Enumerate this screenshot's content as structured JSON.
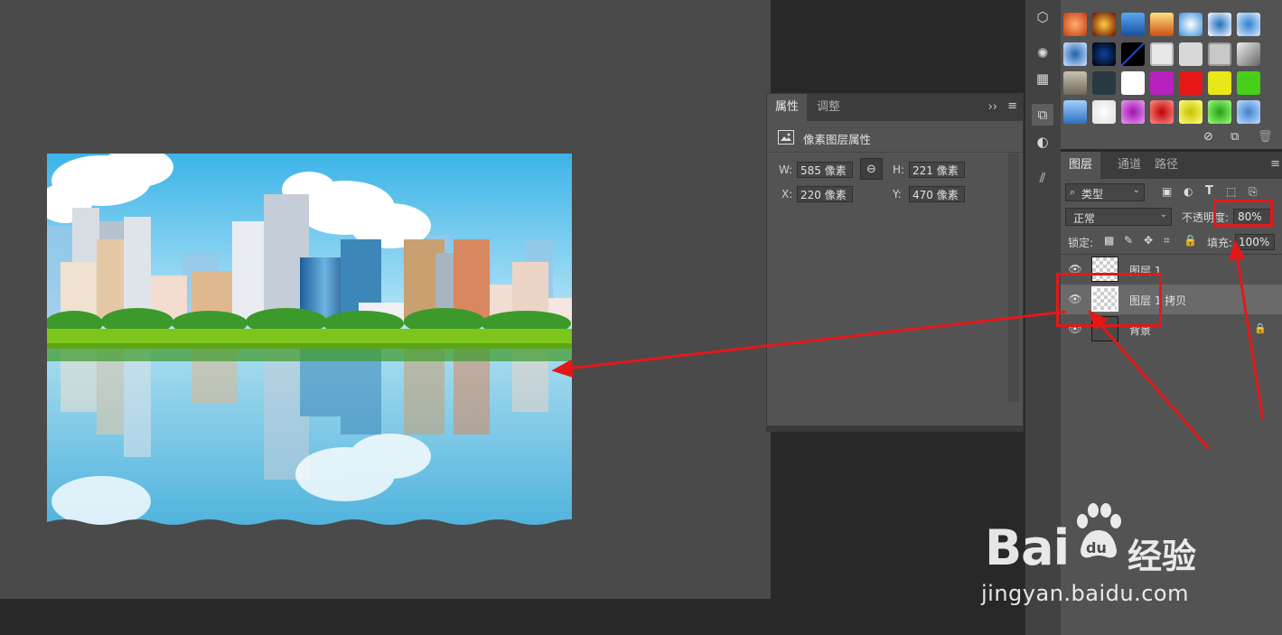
{
  "properties_panel": {
    "tabs": [
      "属性",
      "调整"
    ],
    "section_title": "像素图层属性",
    "w_label": "W:",
    "w_value": "585 像素",
    "h_label": "H:",
    "h_value": "221 像素",
    "x_label": "X:",
    "x_value": "220 像素",
    "y_label": "Y:",
    "y_value": "470 像素"
  },
  "layers_panel": {
    "tabs": [
      "图层",
      "通道",
      "路径"
    ],
    "filter_kind": "类型",
    "blend_mode": "正常",
    "opacity_label": "不透明度:",
    "opacity_value": "80%",
    "lock_label": "锁定:",
    "fill_label": "填充:",
    "fill_value": "100%",
    "layers": [
      {
        "name": "图层 1"
      },
      {
        "name": "图层 1 拷贝"
      },
      {
        "name": "背景"
      }
    ]
  },
  "watermark": {
    "brand": "Bai",
    "brand_du": "du",
    "brand_suffix": "经验",
    "url": "jingyan.baidu.com"
  },
  "colors": {
    "annotation_red": "#e21919",
    "panel_bg": "#535353",
    "canvas_bg": "#4a4a4a",
    "selected_layer": "#6a6a6a"
  }
}
